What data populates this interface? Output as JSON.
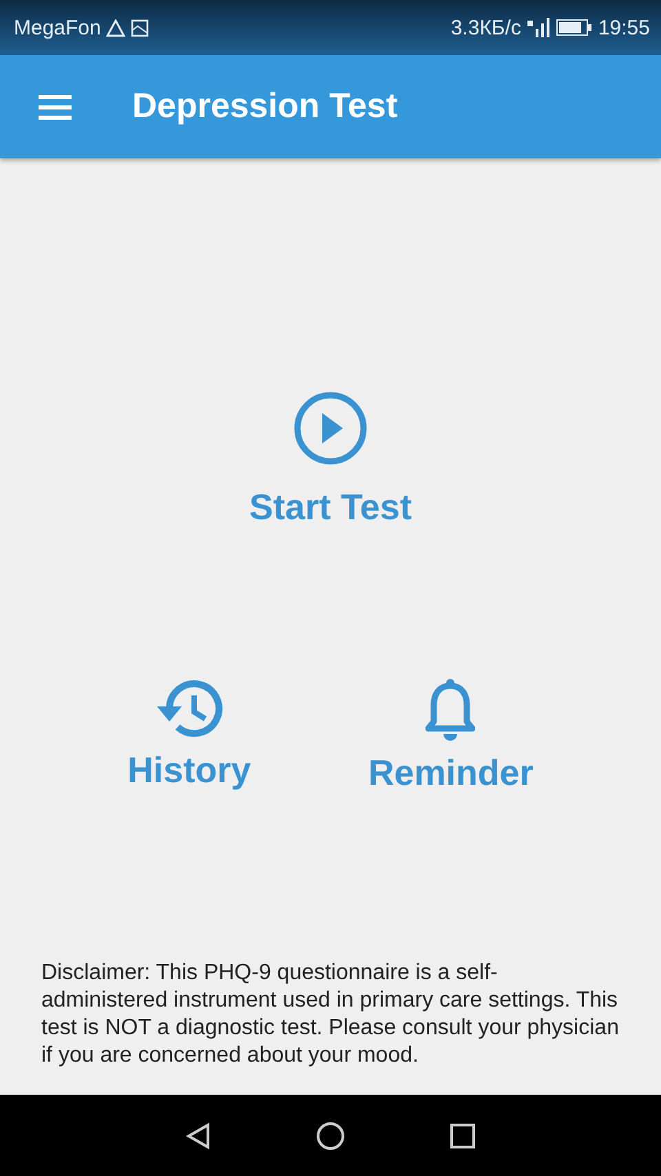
{
  "status_bar": {
    "carrier": "MegaFon",
    "speed": "3.3КБ/с",
    "time": "19:55"
  },
  "app_bar": {
    "title": "Depression Test"
  },
  "actions": [
    {
      "kind": "start",
      "label": "Start Test"
    },
    {
      "kind": "history",
      "label": "History"
    },
    {
      "kind": "reminder",
      "label": "Reminder"
    }
  ],
  "disclaimer": "Disclaimer: This PHQ-9 questionnaire is a self-administered instrument used in primary care settings. This test is NOT a diagnostic test. Please consult your physician if you are concerned about your mood."
}
